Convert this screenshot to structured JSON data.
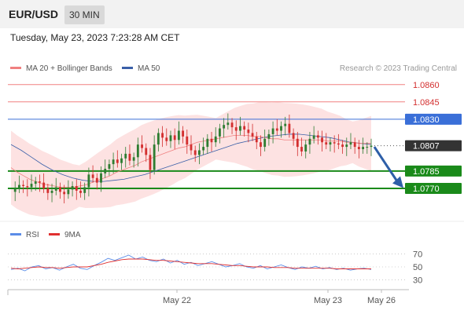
{
  "header": {
    "pair": "EUR/USD",
    "timeframe": "30 MIN",
    "timestamp": "Tuesday, May 23, 2023 7:23:28 AM CET"
  },
  "legend": {
    "ma20": "MA 20 + Bollinger Bands",
    "ma50": "MA 50",
    "credit": "Research © 2023 Trading Central",
    "rsi": "RSI",
    "ma9": "9MA"
  },
  "colors": {
    "resistance": "#f08080",
    "pivot_line": "#3a6fd8",
    "support": "#1a8a1a",
    "current": "#333333",
    "candle_up": "#2e7d32",
    "candle_down": "#d32f2f",
    "bollinger": "#fde2e2",
    "ma50": "#3a5fa8",
    "rsi": "#5b8de8",
    "ma9": "#e03030",
    "arrow": "#2e5fa8"
  },
  "chart_data": [
    {
      "type": "line",
      "title": "EUR/USD 30 MIN",
      "x_ticks": [
        "May 22",
        "May 23",
        "May 26"
      ],
      "ylim": [
        1.0755,
        1.0868
      ],
      "levels": [
        {
          "label": "1.0860",
          "value": 1.086,
          "kind": "resistance"
        },
        {
          "label": "1.0845",
          "value": 1.0845,
          "kind": "resistance"
        },
        {
          "label": "1.0830",
          "value": 1.083,
          "kind": "pivot"
        },
        {
          "label": "1.0807",
          "value": 1.0807,
          "kind": "current"
        },
        {
          "label": "1.0785",
          "value": 1.0785,
          "kind": "support"
        },
        {
          "label": "1.0770",
          "value": 1.077,
          "kind": "support"
        }
      ],
      "forecast": {
        "from": 1.0806,
        "to": 1.0771,
        "direction": "down"
      },
      "price_series": [
        1.0767,
        1.077,
        1.0773,
        1.0772,
        1.0771,
        1.0774,
        1.0776,
        1.0775,
        1.077,
        1.0766,
        1.0768,
        1.0771,
        1.0767,
        1.0765,
        1.0769,
        1.0772,
        1.0768,
        1.0766,
        1.0771,
        1.0782,
        1.0779,
        1.0775,
        1.0783,
        1.0787,
        1.0791,
        1.0795,
        1.0792,
        1.0796,
        1.08,
        1.0794,
        1.0797,
        1.0808,
        1.0805,
        1.0799,
        1.0786,
        1.0808,
        1.0818,
        1.0814,
        1.0811,
        1.0816,
        1.0812,
        1.082,
        1.0815,
        1.0808,
        1.0803,
        1.0799,
        1.0803,
        1.0806,
        1.0813,
        1.081,
        1.0815,
        1.0822,
        1.0825,
        1.0827,
        1.0823,
        1.082,
        1.0824,
        1.0821,
        1.0818,
        1.0815,
        1.081,
        1.0806,
        1.0813,
        1.0817,
        1.0822,
        1.082,
        1.0824,
        1.0826,
        1.0818,
        1.0813,
        1.0806,
        1.0802,
        1.0808,
        1.0813,
        1.0816,
        1.0814,
        1.081,
        1.0808,
        1.081,
        1.0809,
        1.0808,
        1.0806,
        1.0808,
        1.081,
        1.0806,
        1.0804,
        1.0806,
        1.0806,
        1.0807
      ],
      "ma20_series": [
        1.0788,
        1.0784,
        1.0781,
        1.0778,
        1.0776,
        1.0774,
        1.0773,
        1.0772,
        1.0771,
        1.0771,
        1.0771,
        1.0772,
        1.0773,
        1.0775,
        1.0777,
        1.0779,
        1.0781,
        1.0784,
        1.0786,
        1.0788,
        1.079,
        1.0793,
        1.0795,
        1.0797,
        1.0799,
        1.0801,
        1.0803,
        1.0805,
        1.0806,
        1.0808,
        1.081,
        1.0811,
        1.0812,
        1.0813,
        1.0814,
        1.0815,
        1.0816,
        1.0816,
        1.0816,
        1.0815,
        1.0815,
        1.0814,
        1.0813,
        1.0813,
        1.0812,
        1.0812,
        1.0812,
        1.0812,
        1.0812,
        1.0812,
        1.0812,
        1.0811,
        1.0811,
        1.0811,
        1.081,
        1.081,
        1.0809,
        1.0809,
        1.0809
      ],
      "ma50_series": [
        1.0808,
        1.0803,
        1.0797,
        1.0791,
        1.0786,
        1.0782,
        1.0779,
        1.0777,
        1.0776,
        1.0776,
        1.0777,
        1.0778,
        1.078,
        1.0782,
        1.0785,
        1.0788,
        1.0791,
        1.0794,
        1.0797,
        1.08,
        1.0803,
        1.0806,
        1.0809,
        1.0811,
        1.0813,
        1.0815,
        1.0816,
        1.0817,
        1.0817,
        1.0816,
        1.0815,
        1.0814,
        1.0812,
        1.081,
        1.0809,
        1.0808
      ]
    },
    {
      "type": "line",
      "title": "RSI",
      "ylim": [
        20,
        80
      ],
      "y_ticks": [
        70,
        50,
        30
      ],
      "series": [
        {
          "name": "RSI",
          "values": [
            46,
            48,
            44,
            50,
            52,
            47,
            49,
            45,
            50,
            54,
            48,
            46,
            52,
            57,
            63,
            60,
            64,
            68,
            62,
            65,
            60,
            58,
            62,
            56,
            60,
            54,
            57,
            52,
            55,
            58,
            54,
            50,
            52,
            55,
            50,
            48,
            52,
            47,
            50,
            53,
            49,
            46,
            50,
            48,
            51,
            47,
            49,
            46,
            48,
            45,
            47,
            48,
            46
          ]
        },
        {
          "name": "9MA",
          "values": [
            48,
            47,
            48,
            49,
            50,
            49,
            49,
            48,
            49,
            50,
            50,
            50,
            52,
            54,
            57,
            59,
            61,
            62,
            62,
            62,
            61,
            60,
            60,
            59,
            58,
            57,
            56,
            55,
            55,
            55,
            54,
            53,
            52,
            52,
            51,
            50,
            50,
            50,
            49,
            49,
            49,
            48,
            48,
            48,
            48,
            48,
            48,
            47,
            47,
            47,
            47,
            47,
            47
          ]
        }
      ]
    }
  ]
}
